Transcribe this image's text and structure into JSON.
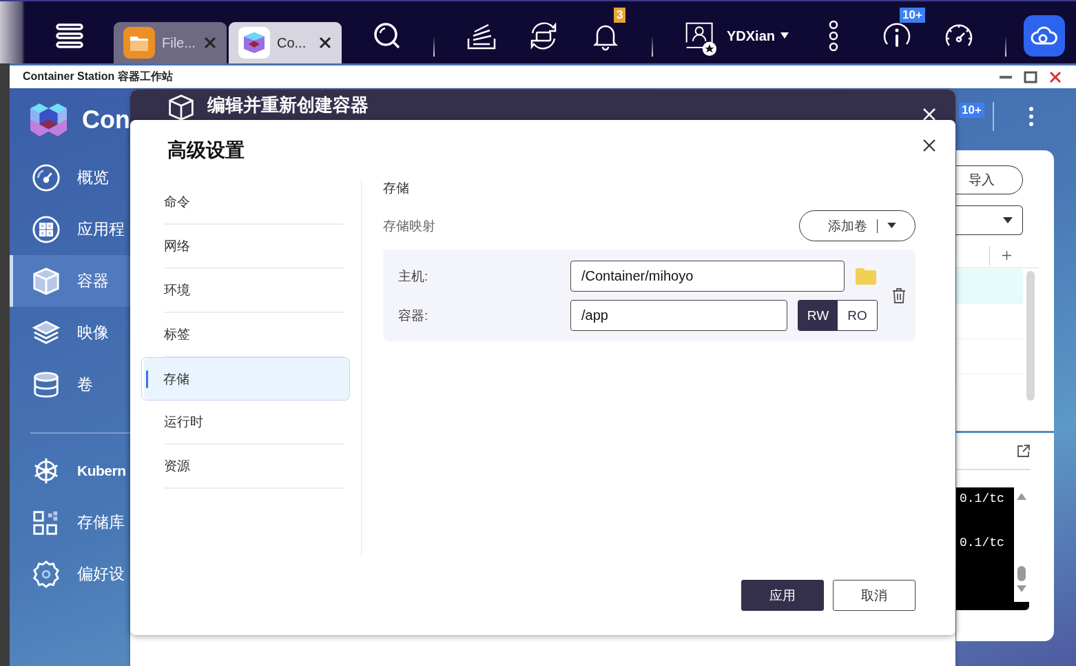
{
  "topbar": {
    "tabs": [
      {
        "label": "File...",
        "selected": false
      },
      {
        "label": "Co...",
        "selected": true
      }
    ],
    "notification_badge": "3",
    "user": "YDXian",
    "info_badge": "10+"
  },
  "window": {
    "title": "Container Station 容器工作站"
  },
  "sidebar": {
    "app_name": "Con",
    "items": [
      {
        "label": "概览",
        "selected": false,
        "kind": "nav"
      },
      {
        "label": "应用程",
        "selected": false,
        "kind": "nav"
      },
      {
        "label": "容器",
        "selected": true,
        "kind": "nav"
      },
      {
        "label": "映像",
        "selected": false,
        "kind": "nav"
      },
      {
        "label": "卷",
        "selected": false,
        "kind": "nav"
      },
      {
        "label": "Kubern",
        "selected": false,
        "kind": "bold"
      },
      {
        "label": "存储库",
        "selected": false,
        "kind": "nav"
      },
      {
        "label": "偏好设",
        "selected": false,
        "kind": "nav"
      }
    ]
  },
  "background": {
    "badge": "10+",
    "rows": [
      {
        "selected": true
      },
      {
        "selected": false
      },
      {
        "selected": false
      }
    ],
    "import_button": "导入",
    "terminal_lines": [
      "0.1/tc",
      "0.1/tc"
    ]
  },
  "edit_dialog": {
    "title": "编辑并重新创建容器"
  },
  "advanced_dialog": {
    "title": "高级设置",
    "menu": [
      {
        "label": "命令",
        "selected": false
      },
      {
        "label": "网络",
        "selected": false
      },
      {
        "label": "环境",
        "selected": false
      },
      {
        "label": "标签",
        "selected": false
      },
      {
        "label": "存储",
        "selected": true
      },
      {
        "label": "运行时",
        "selected": false
      },
      {
        "label": "资源",
        "selected": false
      }
    ],
    "section_title": "存储",
    "mapping_label": "存储映射",
    "add_button": "添加卷",
    "mappings": [
      {
        "host_label": "主机:",
        "host_path": "/Container/mihoyo",
        "container_label": "容器:",
        "container_path": "/app",
        "modes": [
          {
            "label": "RW",
            "selected": true
          },
          {
            "label": "RO",
            "selected": false
          }
        ]
      }
    ],
    "buttons": [
      {
        "label": "应用",
        "kind": "primary"
      },
      {
        "label": "取消",
        "kind": "secondary"
      }
    ]
  }
}
